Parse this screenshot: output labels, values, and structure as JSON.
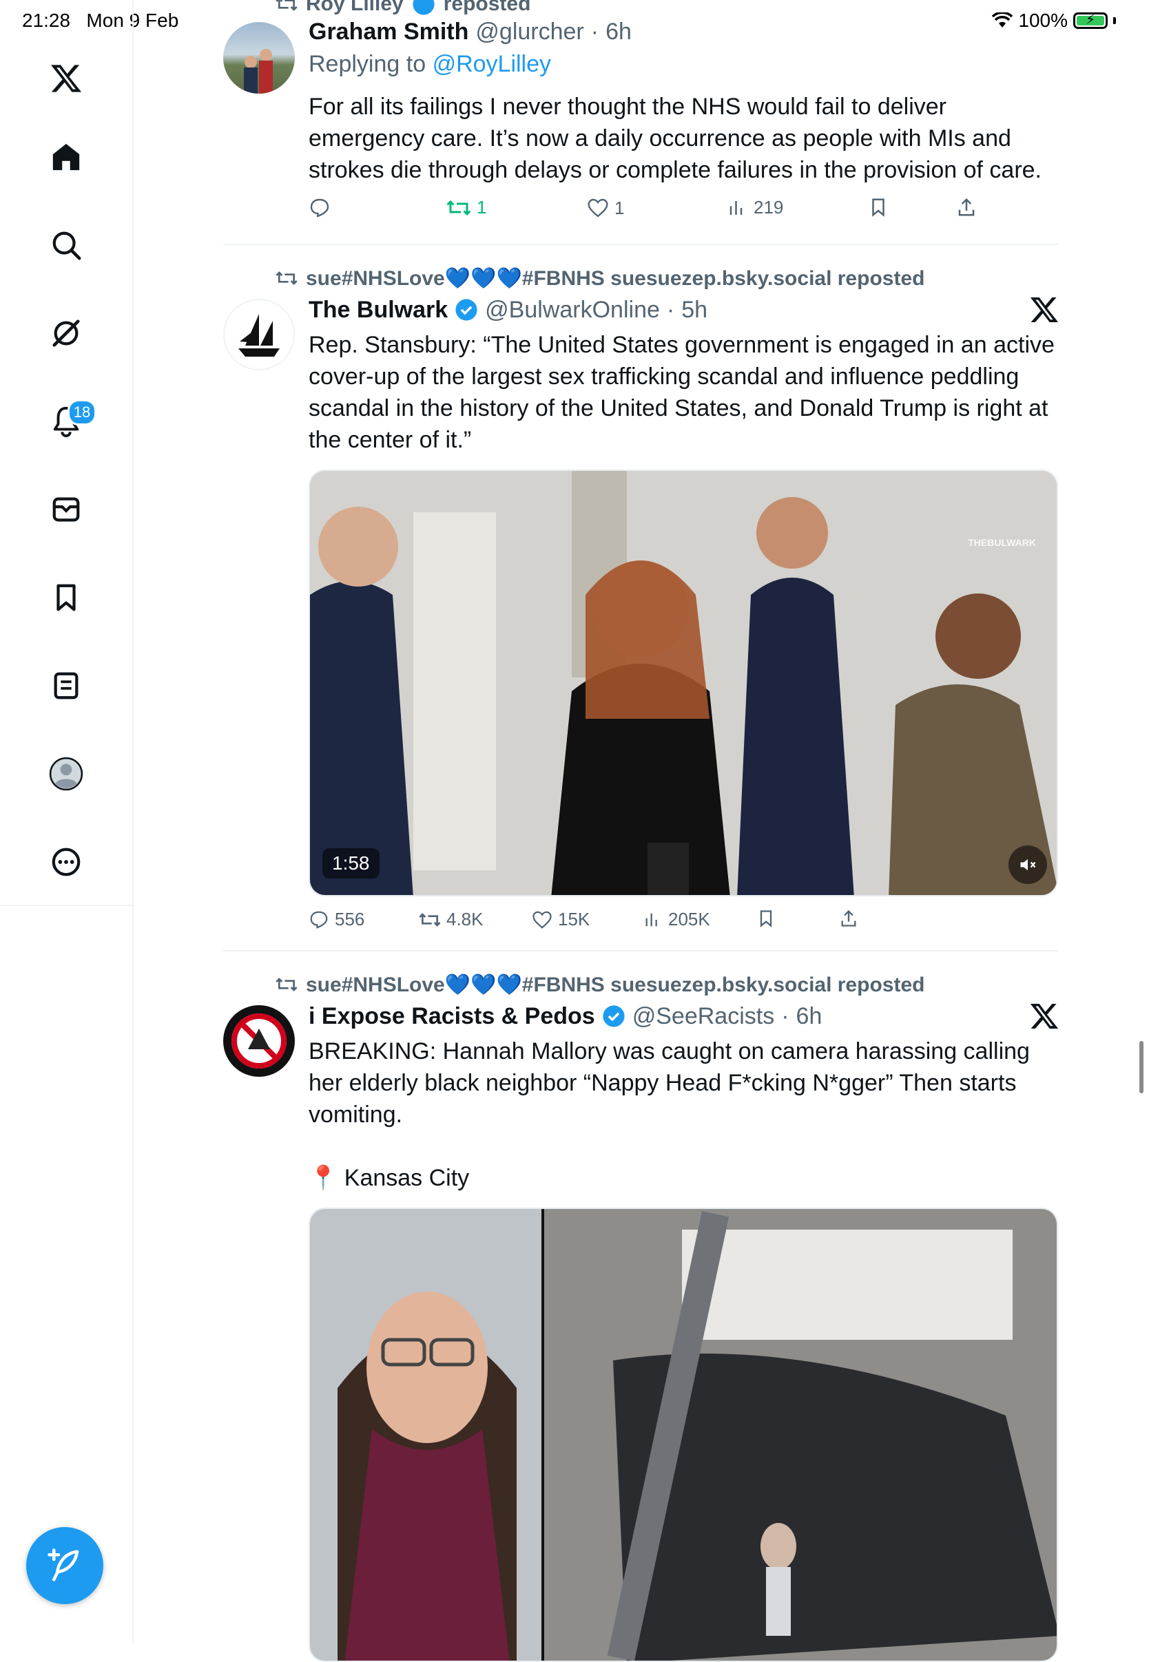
{
  "status": {
    "time": "21:28",
    "date": "Mon 9 Feb",
    "battery": "100%"
  },
  "sidebar": {
    "items": [
      {
        "icon": "x-logo-icon"
      },
      {
        "icon": "home-icon"
      },
      {
        "icon": "search-icon"
      },
      {
        "icon": "grok-icon"
      },
      {
        "icon": "notifications-icon",
        "badge": "18"
      },
      {
        "icon": "messages-icon"
      },
      {
        "icon": "bookmarks-icon"
      },
      {
        "icon": "lists-icon"
      },
      {
        "icon": "profile-icon"
      },
      {
        "icon": "more-icon"
      }
    ],
    "compose_icon": "compose-icon"
  },
  "colors": {
    "accent": "#1d9bf0",
    "retweet_active": "#00ba7c",
    "muted": "#536471"
  },
  "tweets": [
    {
      "top_partial": "Roy Lilley",
      "top_partial_suffix": "reposted",
      "name": "Graham Smith",
      "handle": "@glurcher",
      "time": "6h",
      "reply_label": "Replying to",
      "reply_to": "@RoyLilley",
      "text": "For all its failings I never thought the NHS would fail to deliver emergency care. It’s now a daily occurrence as people with MIs and strokes die through delays or complete failures in the provision of care.",
      "replies": "",
      "retweets": "1",
      "likes": "1",
      "views": "219"
    },
    {
      "repost_by": "sue#NHSLove💙💙💙#FBNHS suesuezep.bsky.social reposted",
      "name": "The Bulwark",
      "handle": "@BulwarkOnline",
      "time": "5h",
      "text": "Rep. Stansbury: “The United States government is engaged in an active cover-up of the largest sex trafficking scandal and influence peddling scandal in the history of the United States, and Donald Trump is right at the center of it.”",
      "video_duration": "1:58",
      "watermark": "THEBULWARK",
      "replies": "556",
      "retweets": "4.8K",
      "likes": "15K",
      "views": "205K"
    },
    {
      "repost_by": "sue#NHSLove💙💙💙#FBNHS suesuezep.bsky.social reposted",
      "name": "i Expose Racists & Pedos",
      "handle": "@SeeRacists",
      "time": "6h",
      "text": "BREAKING: Hannah Mallory was caught on camera harassing calling her elderly black neighbor “Nappy Head F*cking N*gger” Then starts vomiting.",
      "location": "📍 Kansas City"
    }
  ]
}
